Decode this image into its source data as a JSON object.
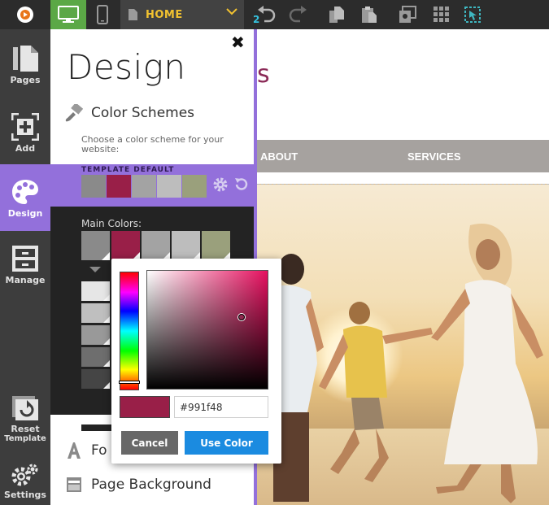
{
  "toolbar": {
    "current_page": "HOME",
    "undo_count": "2",
    "colors": {
      "accent_green": "#5ba846",
      "page_label": "#f2c230"
    }
  },
  "sidebar": {
    "items": [
      {
        "id": "pages",
        "label": "Pages",
        "icon": "pages-icon"
      },
      {
        "id": "add",
        "label": "Add",
        "icon": "add-icon"
      },
      {
        "id": "design",
        "label": "Design",
        "icon": "palette-icon",
        "active": true
      },
      {
        "id": "manage",
        "label": "Manage",
        "icon": "manage-icon"
      },
      {
        "id": "reset",
        "label_line1": "Reset",
        "label_line2": "Template",
        "icon": "reset-template-icon"
      },
      {
        "id": "settings",
        "label": "Settings",
        "icon": "settings-icon"
      }
    ],
    "active_color": "#9370db"
  },
  "panel": {
    "title": "Design",
    "color_schemes": {
      "label": "Color Schemes",
      "description": "Choose a color scheme for your website:",
      "scheme_name": "TEMPLATE DEFAULT",
      "swatches": [
        "#8a8a8a",
        "#991f48",
        "#a3a3a3",
        "#bdbdbd",
        "#9aa07c"
      ]
    },
    "main_colors": {
      "label": "Main Colors:",
      "swatches": [
        "#8a8a8a",
        "#991f48",
        "#a3a3a3",
        "#bdbdbd",
        "#9aa07c"
      ],
      "shades": [
        "#e6e6e6",
        "#bfbfbf",
        "#999999",
        "#6e6e6e",
        "#454545"
      ]
    },
    "fonts_label": "Fo",
    "page_background_label": "Page Background"
  },
  "color_picker": {
    "hex_value": "#991f48",
    "cancel_label": "Cancel",
    "use_label": "Use Color"
  },
  "site": {
    "logo_fragment": "s",
    "nav": [
      "ABOUT",
      "SERVICES"
    ]
  }
}
